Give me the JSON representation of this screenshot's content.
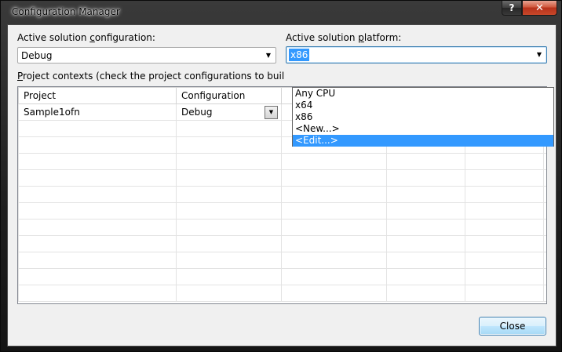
{
  "window": {
    "title": "Configuration Manager",
    "help_glyph": "?",
    "close_glyph": "✕"
  },
  "solution_configuration": {
    "label": "Active solution configuration:",
    "value": "Debug"
  },
  "solution_platform": {
    "label": "Active solution platform:",
    "value": "x86",
    "options": [
      "Any CPU",
      "x64",
      "x86",
      "<New...>",
      "<Edit...>"
    ],
    "highlighted": "<Edit...>"
  },
  "project_contexts": {
    "label": "Project contexts (check the project configurations to build or dep",
    "columns": [
      "Project",
      "Configuration",
      "",
      "",
      "",
      ""
    ],
    "rows": [
      {
        "project": "Sample1ofn",
        "configuration": "Debug"
      }
    ]
  },
  "buttons": {
    "close_label": "Close"
  },
  "icons": {
    "combo_arrow": "▼"
  }
}
